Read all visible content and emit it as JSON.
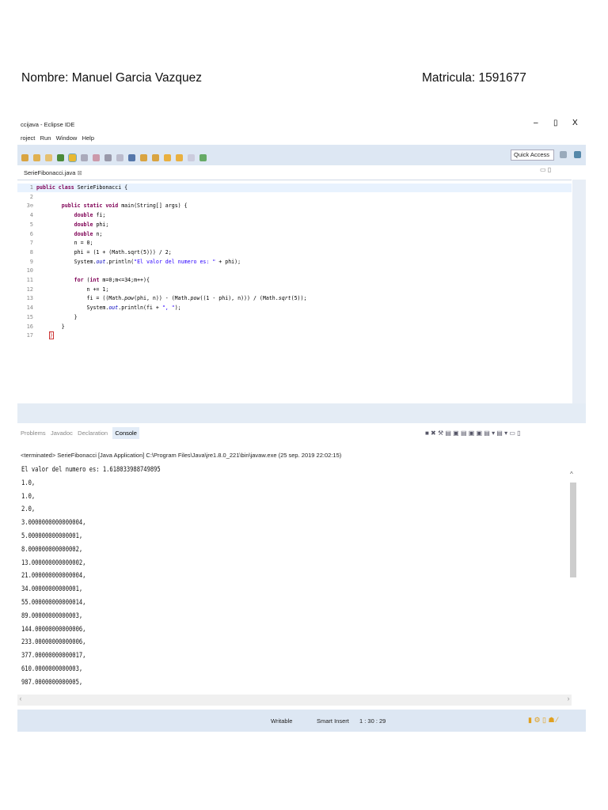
{
  "header": {
    "name": "Nombre: Manuel Garcia Vazquez",
    "matricula": "Matricula: 1591677"
  },
  "window": {
    "title": "ccijava - Eclipse IDE",
    "minimize": "–",
    "maximize": "▯",
    "close": "X"
  },
  "menu": [
    "roject",
    "Run",
    "Window",
    "Help"
  ],
  "toolbar": {
    "quick_access": "Quick Access"
  },
  "editor": {
    "tab": "SerieFibonacci.java",
    "tab_close": "⊠",
    "lines": [
      {
        "n": "1",
        "html": "<span class='kw'>public class</span> SerieFibonacci {"
      },
      {
        "n": "2",
        "html": ""
      },
      {
        "n": "3⊖",
        "html": "        <span class='kw'>public static void</span> main(String[] args) {"
      },
      {
        "n": "4",
        "html": "            <span class='kw'>double</span> fi;"
      },
      {
        "n": "5",
        "html": "            <span class='kw'>double</span> phi;"
      },
      {
        "n": "6",
        "html": "            <span class='kw'>double</span> n;"
      },
      {
        "n": "7",
        "html": "            n = 0;"
      },
      {
        "n": "8",
        "html": "            phi = (1 + (Math.sqrt(5))) / 2;"
      },
      {
        "n": "9",
        "html": "            System.<span class='fld'>out</span>.println(<span class='str'>\"El valor del numero es: \"</span> + phi);"
      },
      {
        "n": "10",
        "html": ""
      },
      {
        "n": "11",
        "html": "            <span class='kw'>for</span> (<span class='kw'>int</span> m=0;m<=34;m++){"
      },
      {
        "n": "12",
        "html": "                n += 1;"
      },
      {
        "n": "13",
        "html": "                fi = ((Math.<i>pow</i>(phi, n)) - (Math.<i>pow</i>((1 - phi), n))) / (Math.<i>sqrt</i>(5));"
      },
      {
        "n": "14",
        "html": "                System.<span class='fld'>out</span>.println(fi + <span class='str'>\", \"</span>);"
      },
      {
        "n": "15",
        "html": "            }"
      },
      {
        "n": "16",
        "html": "        }"
      },
      {
        "n": "17",
        "html": "    <span style='border:1px solid #c33;color:#c33'>}</span>"
      }
    ]
  },
  "console": {
    "tabs": [
      "Problems",
      "Javadoc",
      "Declaration",
      "Console"
    ],
    "status": "<terminated> SerieFibonacci [Java Application] C:\\Program Files\\Java\\jre1.8.0_221\\bin\\javaw.exe (25 sep. 2019 22:02:15)",
    "output": [
      "El valor del numero es: 1.618033988749895",
      "1.0,",
      "1.0,",
      "2.0,",
      "3.0000000000000004,",
      "5.000000000000001,",
      "8.000000000000002,",
      "13.000000000000002,",
      "21.000000000000004,",
      "34.00000000000001,",
      "55.000000000000014,",
      "89.00000000000003,",
      "144.00000000000006,",
      "233.00000000000006,",
      "377.00000000000017,",
      "610.0000000000003,",
      "987.0000000000005,"
    ]
  },
  "statusbar": {
    "writable": "Writable",
    "insert": "Smart Insert",
    "position": "1 : 30 : 29"
  }
}
